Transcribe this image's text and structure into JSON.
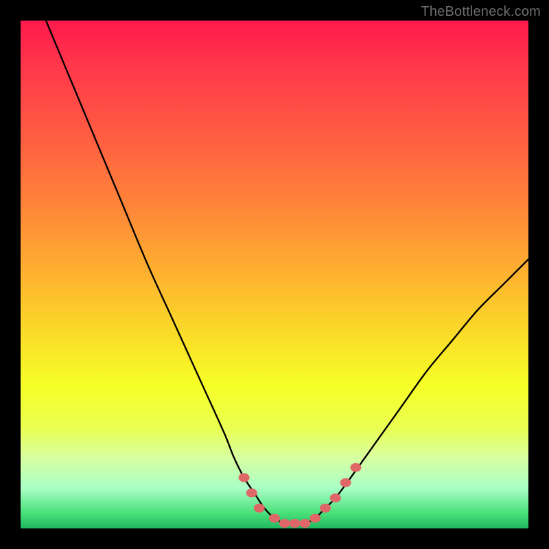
{
  "watermark": "TheBottleneck.com",
  "chart_data": {
    "type": "line",
    "title": "",
    "xlabel": "",
    "ylabel": "",
    "xlim": [
      0,
      100
    ],
    "ylim": [
      0,
      100
    ],
    "series": [
      {
        "name": "bottleneck-curve",
        "x": [
          5,
          10,
          15,
          20,
          25,
          30,
          35,
          40,
          42,
          44,
          46,
          48,
          50,
          52,
          54,
          56,
          58,
          60,
          62,
          65,
          70,
          75,
          80,
          85,
          90,
          95,
          100
        ],
        "y": [
          100,
          88,
          76,
          64,
          52,
          41,
          30,
          19,
          14,
          10,
          7,
          4,
          2,
          1,
          1,
          1,
          2,
          4,
          6,
          10,
          17,
          24,
          31,
          37,
          43,
          48,
          53
        ]
      }
    ],
    "markers": {
      "name": "highlight-points",
      "color": "#e06767",
      "points": [
        {
          "x": 44,
          "y": 10
        },
        {
          "x": 45.5,
          "y": 7
        },
        {
          "x": 47,
          "y": 4
        },
        {
          "x": 50,
          "y": 2
        },
        {
          "x": 52,
          "y": 1
        },
        {
          "x": 54,
          "y": 1
        },
        {
          "x": 56,
          "y": 1
        },
        {
          "x": 58,
          "y": 2
        },
        {
          "x": 60,
          "y": 4
        },
        {
          "x": 62,
          "y": 6
        },
        {
          "x": 64,
          "y": 9
        },
        {
          "x": 66,
          "y": 12
        }
      ]
    },
    "background_gradient": {
      "top": "#ff1a4d",
      "mid": "#fadd28",
      "bottom": "#1fb85f"
    }
  }
}
